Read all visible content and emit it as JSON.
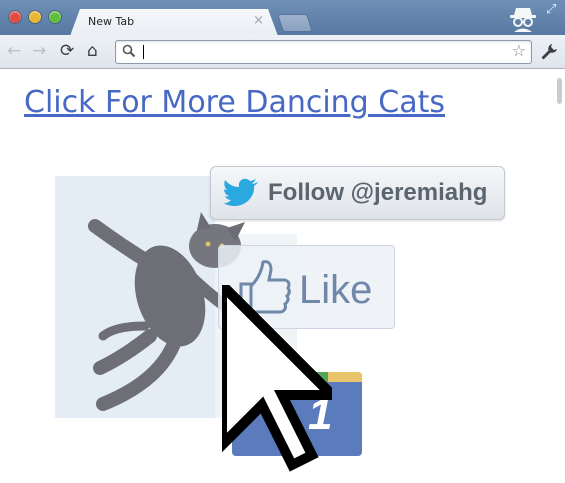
{
  "tab": {
    "title": "New Tab"
  },
  "toolbar": {
    "address_value": "",
    "address_placeholder": ""
  },
  "page": {
    "headline_link": "Click For More Dancing Cats",
    "twitter_button_label": "Follow @jeremiahg",
    "like_button_label": "Like",
    "plusone_count": "1"
  },
  "icons": {
    "close": "×",
    "back": "←",
    "forward": "→",
    "reload": "⟳",
    "home": "⌂",
    "star": "☆",
    "resize": "⤢"
  },
  "colors": {
    "link": "#4768c4",
    "titlebar": "#6f8fb6",
    "twitter_bird": "#2aa9e0",
    "like_text": "#6f87a8",
    "plusone_blue": "#5b7bbd"
  }
}
